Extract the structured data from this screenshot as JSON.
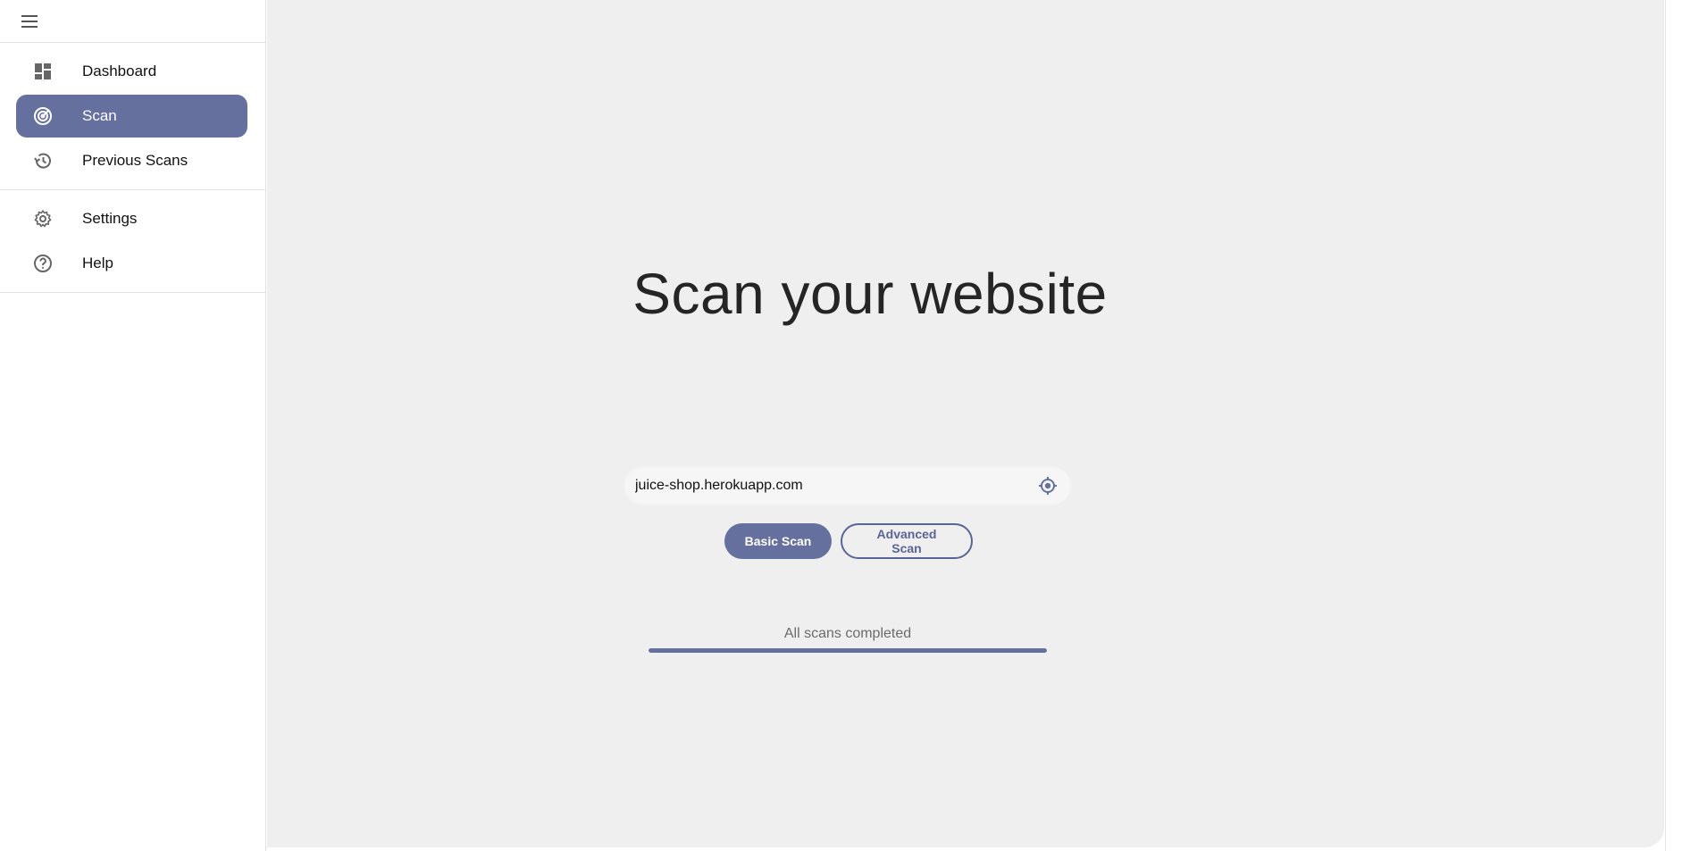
{
  "sidebar": {
    "menu_icon": "hamburger-menu-icon",
    "primary_items": [
      {
        "label": "Dashboard",
        "icon": "dashboard-icon",
        "active": false
      },
      {
        "label": "Scan",
        "icon": "radar-target-icon",
        "active": true
      },
      {
        "label": "Previous Scans",
        "icon": "history-icon",
        "active": false
      }
    ],
    "secondary_items": [
      {
        "label": "Settings",
        "icon": "gear-icon",
        "active": false
      },
      {
        "label": "Help",
        "icon": "help-circle-icon",
        "active": false
      }
    ]
  },
  "main": {
    "headline": "Scan your website",
    "search": {
      "value": "juice-shop.herokuapp.com",
      "placeholder": "",
      "icon": "crosshair-target-icon"
    },
    "buttons": {
      "basic": "Basic Scan",
      "advanced": "Advanced Scan"
    },
    "status": {
      "text": "All scans completed",
      "progress_percent": 100
    }
  },
  "colors": {
    "accent": "#66709f",
    "main_background": "#efeff0",
    "outline_button": "#5a6596"
  }
}
